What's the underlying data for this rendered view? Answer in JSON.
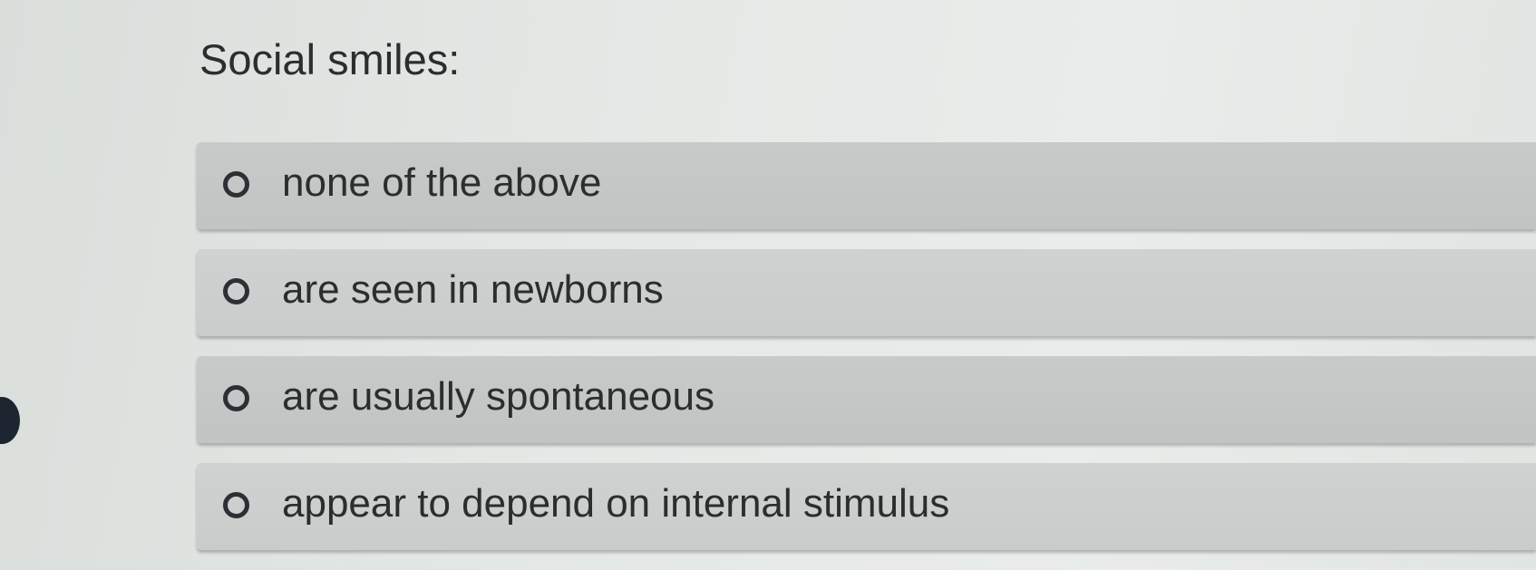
{
  "question": {
    "title": "Social smiles:"
  },
  "options": [
    {
      "label": "none of the above",
      "selected": false
    },
    {
      "label": "are seen in newborns",
      "selected": false
    },
    {
      "label": "are usually spontaneous",
      "selected": false
    },
    {
      "label": "appear to depend on internal stimulus",
      "selected": false
    }
  ],
  "colors": {
    "background": "#e4e8e5",
    "option_background": "#c4c8c6",
    "text": "#2b2d2f",
    "radio_border": "#2c2f33"
  },
  "icons": {
    "radio": "radio-unchecked-icon"
  }
}
